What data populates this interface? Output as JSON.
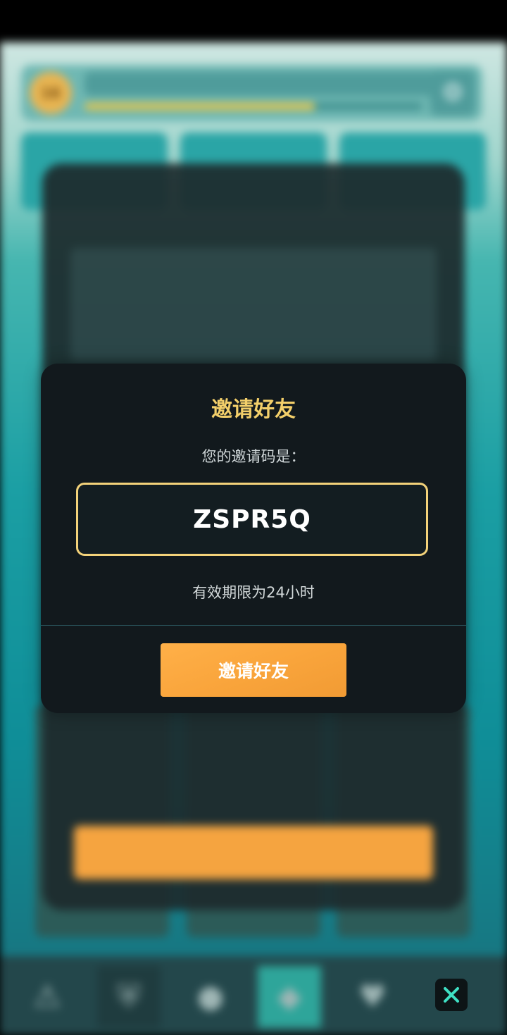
{
  "modal": {
    "title": "邀请好友",
    "prompt": "您的邀请码是：",
    "code": "ZSPR5Q",
    "expire_text": "有效期限为24小时",
    "button_label": "邀请好友"
  },
  "background": {
    "level": "16"
  },
  "colors": {
    "accent_gold": "#f3cf6a",
    "button_orange": "#f9a43b",
    "modal_bg": "#12191d",
    "close_x": "#3fe0c4"
  },
  "icons": {
    "close": "close-icon",
    "settings": "gear-icon",
    "nav": [
      "warning-icon",
      "shield-icon",
      "coin-icon",
      "diamond-icon",
      "heart-icon"
    ]
  }
}
